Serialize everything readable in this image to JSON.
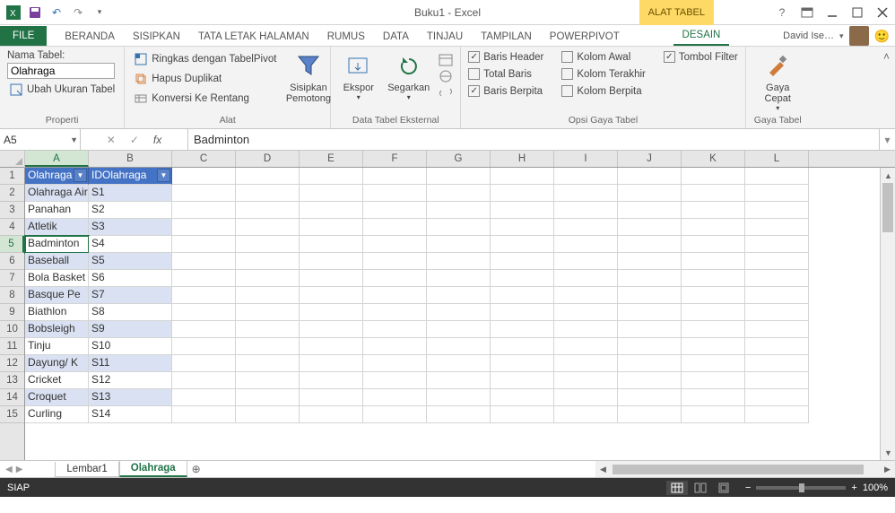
{
  "app": {
    "title": "Buku1 - Excel"
  },
  "contextualTab": "ALAT TABEL",
  "tabs": {
    "file": "FILE",
    "items": [
      "BERANDA",
      "SISIPKAN",
      "TATA LETAK HALAMAN",
      "RUMUS",
      "DATA",
      "TINJAU",
      "TAMPILAN",
      "POWERPIVOT"
    ],
    "design": "DESAIN"
  },
  "user": {
    "name": "David Ise…"
  },
  "ribbon": {
    "properties": {
      "tableNameLabel": "Nama Tabel:",
      "tableName": "Olahraga",
      "resize": "Ubah Ukuran Tabel",
      "groupLabel": "Properti"
    },
    "tools": {
      "pivot": "Ringkas dengan TabelPivot",
      "dup": "Hapus Duplikat",
      "range": "Konversi Ke Rentang",
      "slicer": "Sisipkan\nPemotong",
      "groupLabel": "Alat"
    },
    "external": {
      "export": "Ekspor",
      "refresh": "Segarkan",
      "groupLabel": "Data Tabel Eksternal"
    },
    "styleOpts": {
      "headerRow": "Baris Header",
      "totalRow": "Total Baris",
      "banded": "Baris Berpita",
      "firstCol": "Kolom Awal",
      "lastCol": "Kolom Terakhir",
      "bandedCol": "Kolom Berpita",
      "filterBtn": "Tombol Filter",
      "groupLabel": "Opsi Gaya Tabel"
    },
    "styles": {
      "quick": "Gaya\nCepat",
      "groupLabel": "Gaya Tabel"
    }
  },
  "formulaBar": {
    "nameBox": "A5",
    "formula": "Badminton"
  },
  "columns": [
    "A",
    "B",
    "C",
    "D",
    "E",
    "F",
    "G",
    "H",
    "I",
    "J",
    "K",
    "L"
  ],
  "rows": [
    "1",
    "2",
    "3",
    "4",
    "5",
    "6",
    "7",
    "8",
    "9",
    "10",
    "11",
    "12",
    "13",
    "14",
    "15"
  ],
  "activeCell": {
    "row": 5,
    "col": "A"
  },
  "tableHeaders": [
    "Olahraga",
    "IDOlahraga"
  ],
  "tableData": [
    [
      "Olahraga Air",
      "S1"
    ],
    [
      "Panahan",
      "S2"
    ],
    [
      "Atletik",
      "S3"
    ],
    [
      "Badminton",
      "S4"
    ],
    [
      "Baseball",
      "S5"
    ],
    [
      "Bola Basket",
      "S6"
    ],
    [
      "Basque Pe",
      "S7"
    ],
    [
      "Biathlon",
      "S8"
    ],
    [
      "Bobsleigh",
      "S9"
    ],
    [
      "Tinju",
      "S10"
    ],
    [
      "Dayung/ K",
      "S11"
    ],
    [
      "Cricket",
      "S12"
    ],
    [
      "Croquet",
      "S13"
    ],
    [
      "Curling",
      "S14"
    ]
  ],
  "sheets": {
    "tab1": "Lembar1",
    "tab2": "Olahraga"
  },
  "statusBar": {
    "ready": "SIAP",
    "zoom": "100%"
  }
}
